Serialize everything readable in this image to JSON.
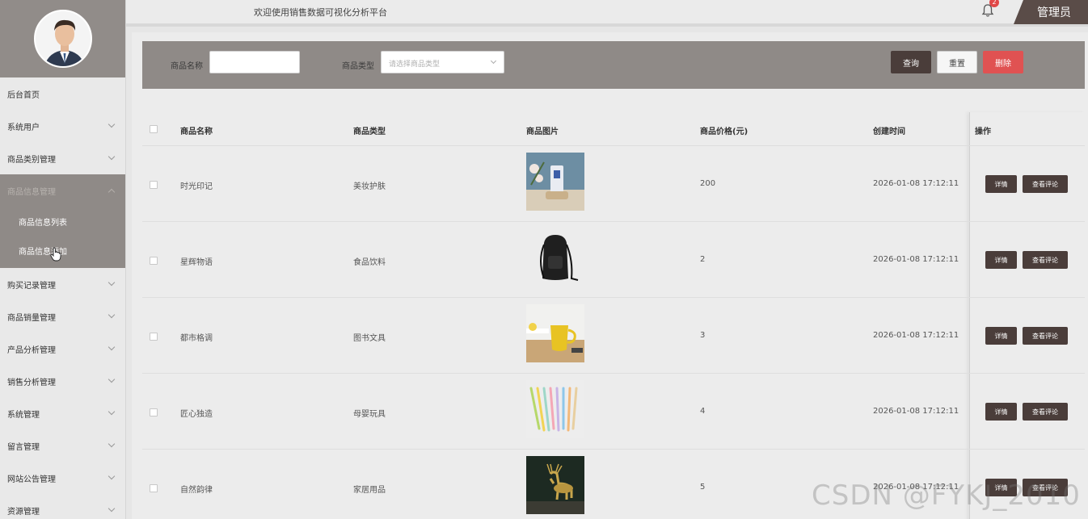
{
  "header": {
    "welcome": "欢迎使用销售数据可视化分析平台",
    "notification_count": "2",
    "admin_label": "管理员"
  },
  "sidebar": {
    "items": [
      {
        "label": "后台首页",
        "chevron": false
      },
      {
        "label": "系统用户",
        "chevron": true
      },
      {
        "label": "商品类别管理",
        "chevron": true
      },
      {
        "label": "商品信息管理",
        "chevron": true,
        "open": true
      },
      {
        "label": "购买记录管理",
        "chevron": true
      },
      {
        "label": "商品销量管理",
        "chevron": true
      },
      {
        "label": "产品分析管理",
        "chevron": true
      },
      {
        "label": "销售分析管理",
        "chevron": true
      },
      {
        "label": "系统管理",
        "chevron": true
      },
      {
        "label": "留言管理",
        "chevron": true
      },
      {
        "label": "网站公告管理",
        "chevron": true
      },
      {
        "label": "资源管理",
        "chevron": true
      }
    ],
    "submenu": [
      {
        "label": "商品信息列表"
      },
      {
        "label": "商品信息添加"
      }
    ]
  },
  "search": {
    "name_label": "商品名称",
    "name_value": "",
    "type_label": "商品类型",
    "type_placeholder": "请选择商品类型",
    "query_label": "查询",
    "reset_label": "重置",
    "delete_label": "删除"
  },
  "table": {
    "headers": [
      "商品名称",
      "商品类型",
      "商品图片",
      "商品价格(元)",
      "创建时间",
      "操作"
    ],
    "rows": [
      {
        "name": "时光印记",
        "type": "美妆护肤",
        "image": "cosmetic-bottle-image",
        "price": "200",
        "created": "2026-01-08 17:12:11"
      },
      {
        "name": "星辉物语",
        "type": "食品饮料",
        "image": "backpack-image",
        "price": "2",
        "created": "2026-01-08 17:12:11"
      },
      {
        "name": "都市格调",
        "type": "图书文具",
        "image": "yellow-mug-image",
        "price": "3",
        "created": "2026-01-08 17:12:11"
      },
      {
        "name": "匠心独造",
        "type": "母婴玩具",
        "image": "colored-pens-image",
        "price": "4",
        "created": "2026-01-08 17:12:11"
      },
      {
        "name": "自然韵律",
        "type": "家居用品",
        "image": "deer-statue-image",
        "price": "5",
        "created": "2026-01-08 17:12:11"
      }
    ],
    "detail_label": "详情",
    "comment_label": "查看评论"
  },
  "watermark": "CSDN @FYKJ_2010",
  "colors": {
    "accent_dark": "#4a3d3a",
    "panel_gray": "#8f8a87",
    "danger": "#e05252"
  }
}
